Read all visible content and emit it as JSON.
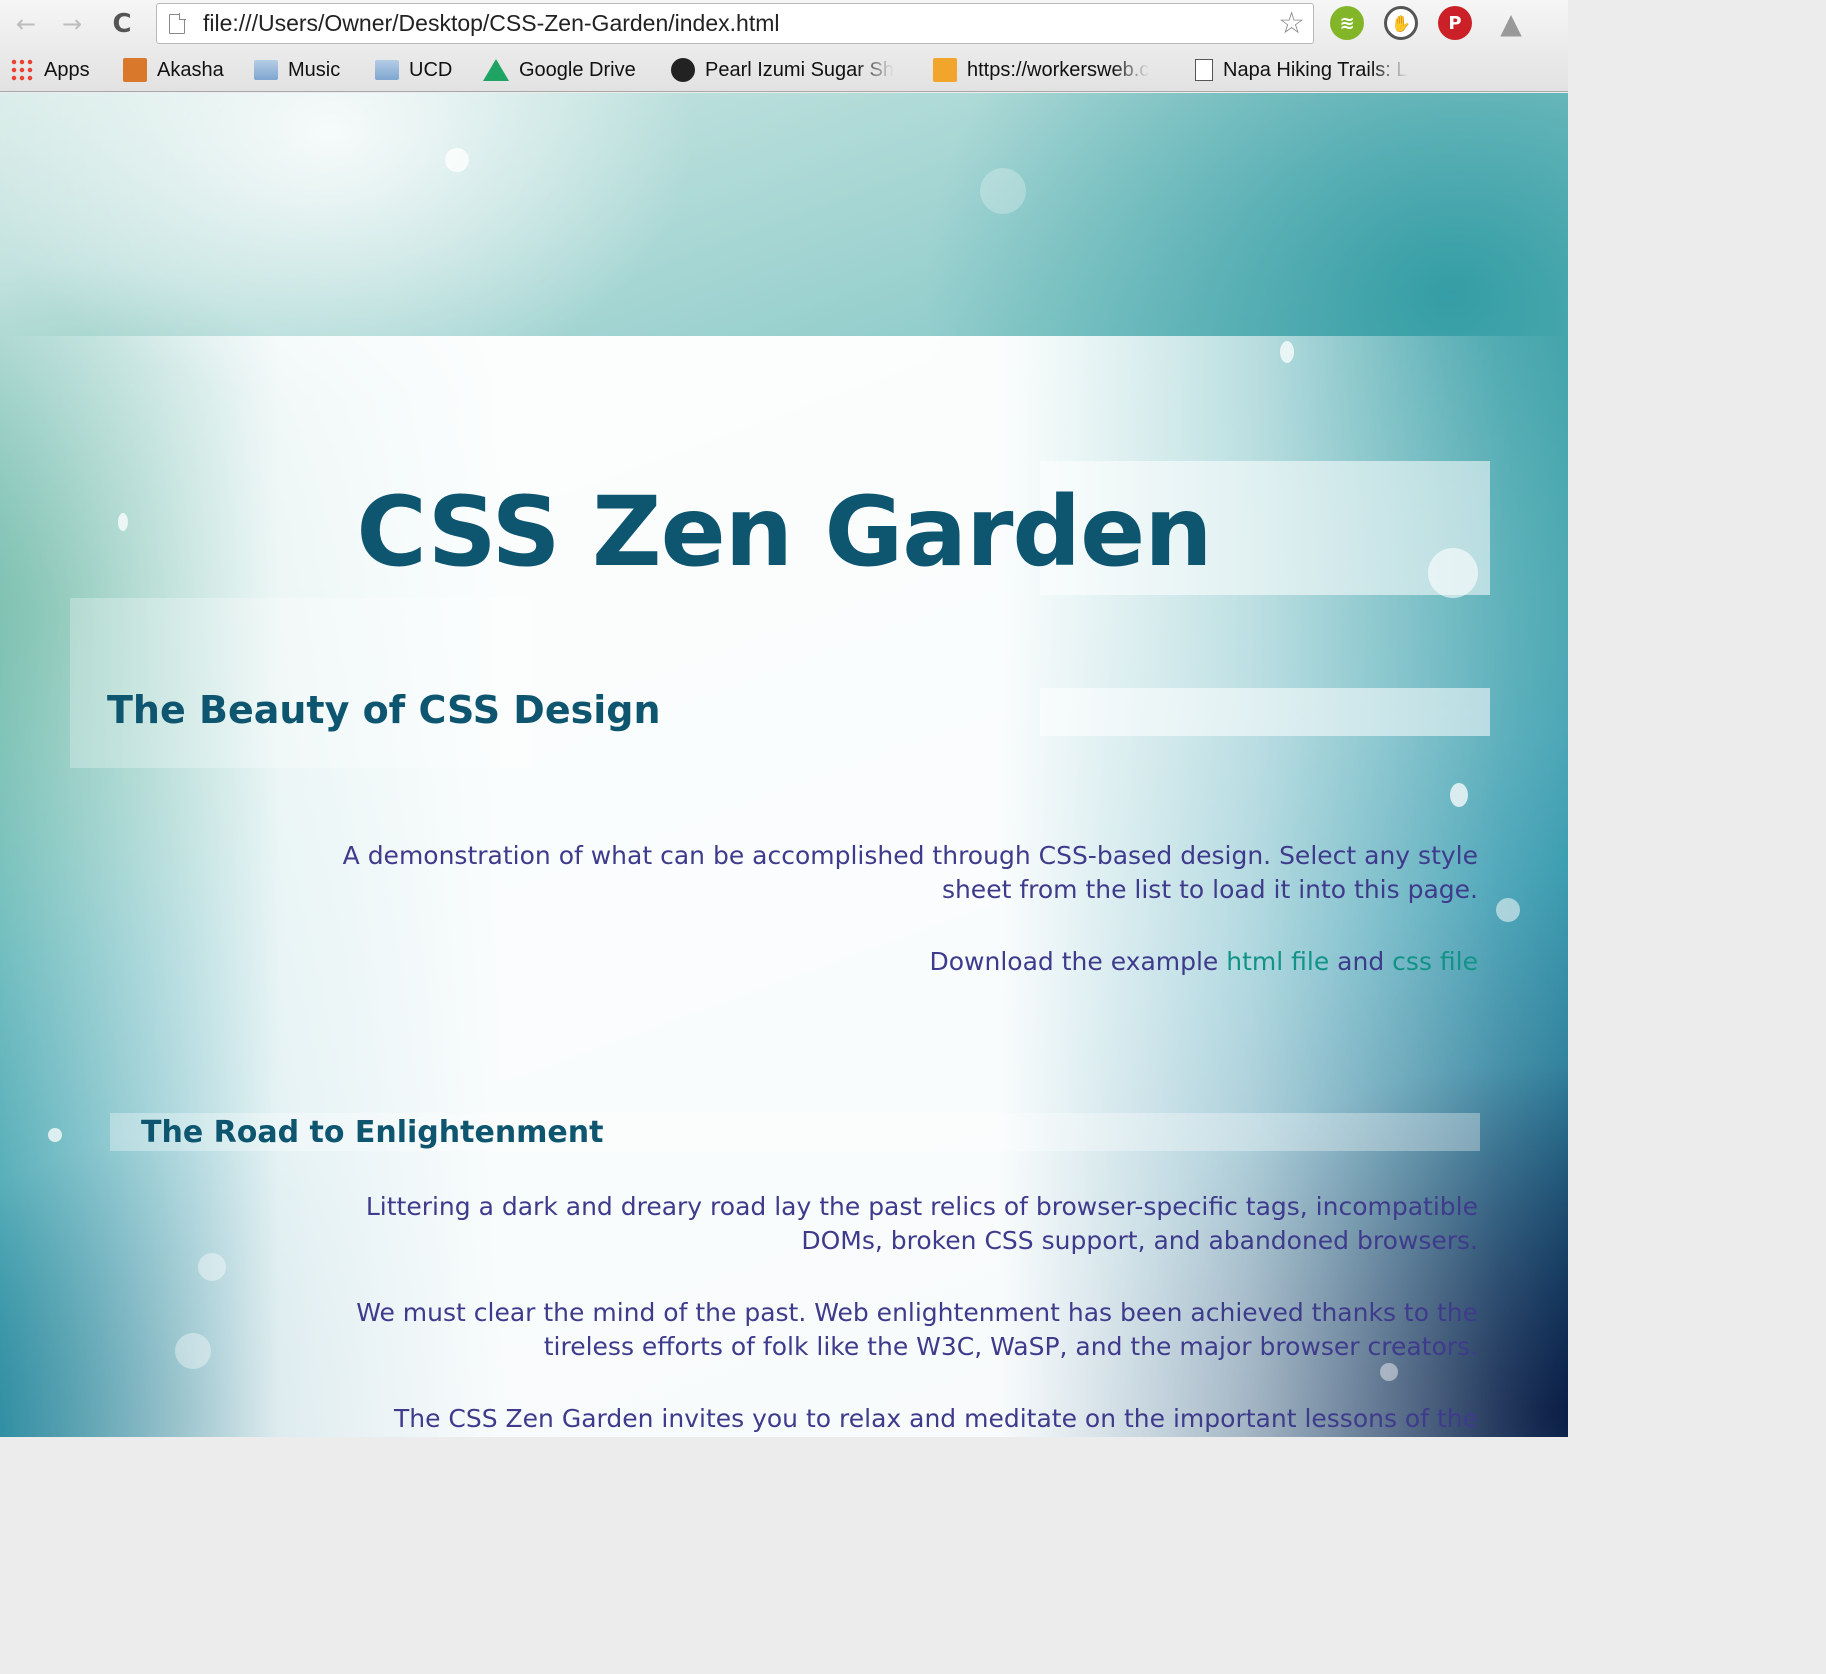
{
  "browser": {
    "url": "file:///Users/Owner/Desktop/CSS-Zen-Garden/index.html",
    "nav": {
      "back_icon": "←",
      "forward_icon": "→",
      "reload_icon": "C"
    },
    "star_icon": "☆",
    "extensions": [
      {
        "name": "spotify-icon",
        "glyph": "≋"
      },
      {
        "name": "hand-icon",
        "glyph": "✋"
      },
      {
        "name": "pinterest-icon",
        "glyph": "P"
      },
      {
        "name": "drive-icon",
        "glyph": "▲"
      }
    ],
    "bookmarks": [
      {
        "label": "Apps",
        "icon": "apps-grid-icon"
      },
      {
        "label": "Akasha",
        "icon": "akasha-yoga-icon"
      },
      {
        "label": "Music",
        "icon": "folder-icon"
      },
      {
        "label": "UCD",
        "icon": "folder-icon"
      },
      {
        "label": "Google Drive",
        "icon": "google-drive-icon"
      },
      {
        "label": "Pearl Izumi Sugar Sh",
        "icon": "pearl-izumi-icon"
      },
      {
        "label": "https://workersweb.c",
        "icon": "box-icon"
      },
      {
        "label": "Napa Hiking Trails: L",
        "icon": "page-icon"
      }
    ]
  },
  "page": {
    "title": "CSS Zen Garden",
    "subtitle": "The Beauty of CSS Design",
    "intro": {
      "line1": "A demonstration of what can be accomplished through CSS-based design. Select any style",
      "line2": "sheet from the list to load it into this page.",
      "download_prefix": "Download the example ",
      "html_link": "html file",
      "and": " and ",
      "css_link": "css file"
    },
    "section": {
      "heading": "The Road to Enlightenment",
      "p1_line1": "Littering a dark and dreary road lay the past relics of browser-specific tags, incompatible",
      "p1_line2": "DOMs, broken CSS support, and abandoned browsers.",
      "p2_line1": "We must clear the mind of the past. Web enlightenment has been achieved thanks to the",
      "p2_line2": "tireless efforts of folk like the W3C, WaSP, and the major browser creators.",
      "p3_line1": "The CSS Zen Garden invites you to relax and meditate on the important lessons of the"
    }
  },
  "colors": {
    "heading": "#0e5570",
    "body_text": "#3f3b8c",
    "link": "#129388"
  }
}
